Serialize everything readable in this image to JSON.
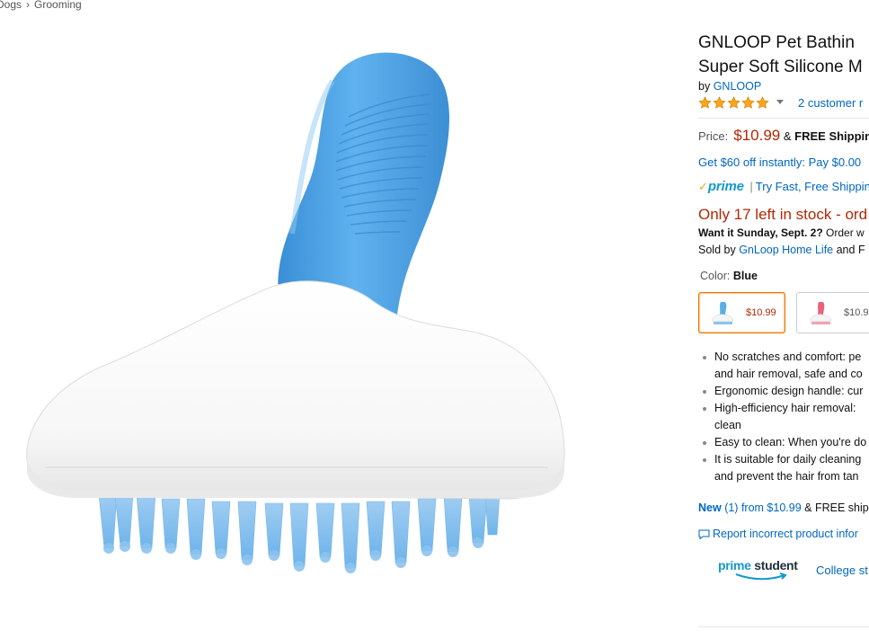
{
  "breadcrumb": {
    "items": [
      "Dogs",
      "Grooming"
    ],
    "separator": "›"
  },
  "product": {
    "title_line1": "GNLOOP Pet Bathin",
    "title_line2": "Super Soft Silicone M",
    "by_prefix": "by",
    "brand": "GNLOOP",
    "rating_stars": 5,
    "reviews_text": "2 customer r",
    "price_label": "Price:",
    "price": "$10.99",
    "price_amp": "&",
    "shipping": "FREE Shipping",
    "offer_text": "Get $60 off instantly: Pay $0.00",
    "prime_check": "✓",
    "prime_label": "prime",
    "prime_pipe": "|",
    "prime_link": "Try Fast, Free Shippin",
    "stock_text": "Only 17 left in stock - ord",
    "delivery_bold": "Want it Sunday, Sept. 2?",
    "delivery_rest": "Order w",
    "sold_prefix": "Sold by",
    "seller": "GnLoop Home Life",
    "sold_and": "and F",
    "color_label": "Color:",
    "color_value": "Blue",
    "swatches": [
      {
        "price": "$10.99",
        "color": "#5aaee8",
        "selected": true
      },
      {
        "price": "$10.9",
        "color": "#e8637a",
        "selected": false
      }
    ],
    "bullets": [
      {
        "line1": "No scratches and comfort: pe",
        "line2": "and hair removal, safe and co"
      },
      {
        "line1": "Ergonomic design handle: cur",
        "line2": ""
      },
      {
        "line1": "High-efficiency hair removal: ",
        "line2": "clean"
      },
      {
        "line1": "Easy to clean: When you're do",
        "line2": ""
      },
      {
        "line1": "It is suitable for daily cleaning",
        "line2": "and prevent the hair from tan"
      }
    ],
    "new_link": "New",
    "new_count": "(1) from $10.99",
    "new_rest": "& FREE ship",
    "report_text": "Report incorrect product infor",
    "prime_student_prime": "prime",
    "prime_student_student": "student",
    "college_text": "College st"
  },
  "colors": {
    "link": "#0066c0",
    "price": "#b12704",
    "star": "#ffa41c",
    "prime": "#1399cc",
    "brush_blue": "#5aaee8"
  }
}
